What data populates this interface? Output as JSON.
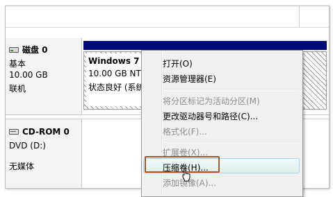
{
  "disk0": {
    "title": "磁盘 0",
    "type": "基本",
    "size": "10.00 GB",
    "status": "联机",
    "partition": {
      "name": "Windows 7 （",
      "size": "10.00 GB NTF",
      "status": "状态良好 (系统"
    }
  },
  "cdrom0": {
    "title": "CD-ROM 0",
    "drive": "DVD (D:)",
    "media": "无媒体"
  },
  "context_menu": {
    "items": [
      {
        "label": "打开(O)",
        "enabled": true
      },
      {
        "label": "资源管理器(E)",
        "enabled": true
      },
      {
        "label": "将分区标记为活动分区(M)",
        "enabled": false
      },
      {
        "label": "更改驱动器号和路径(C)...",
        "enabled": true
      },
      {
        "label": "格式化(F)...",
        "enabled": false
      },
      {
        "label": "扩展卷(X)...",
        "enabled": false
      },
      {
        "label": "压缩卷(H)...",
        "enabled": true
      },
      {
        "label": "添加镜像(A)...",
        "enabled": false
      }
    ],
    "hovered_item": "压缩卷(H)..."
  },
  "colors": {
    "partition_header": "#000c7a",
    "highlight_border": "#9a5a2c",
    "disabled_text": "#8d8d8d"
  },
  "icons": [
    "hard-disk-icon",
    "cd-rom-icon",
    "mouse-pointer-icon"
  ]
}
